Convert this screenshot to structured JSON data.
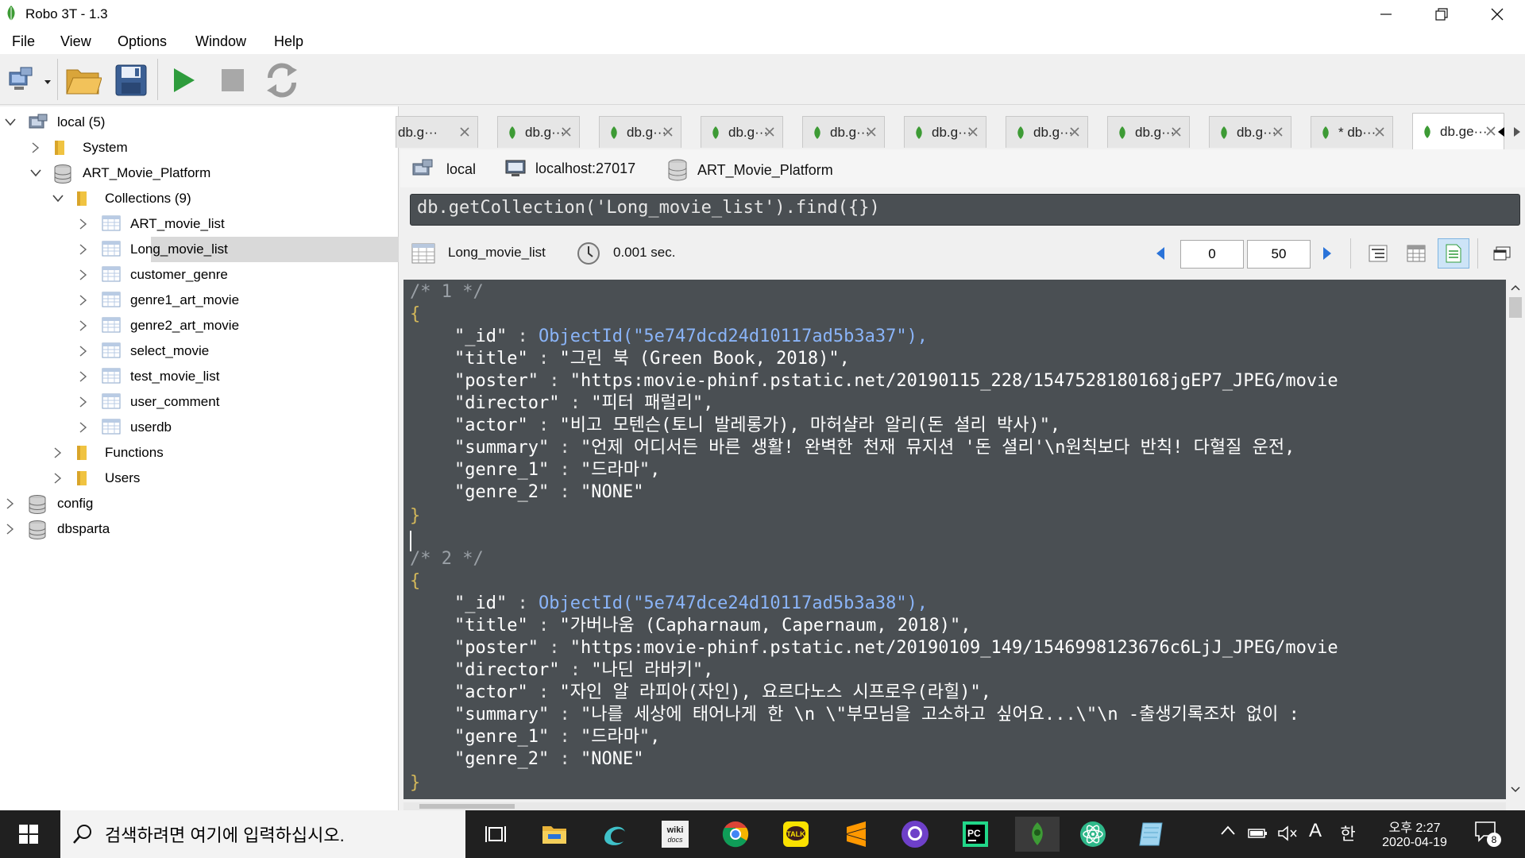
{
  "window": {
    "title": "Robo 3T - 1.3",
    "minimize": "—",
    "restore": "❐",
    "close": "✕"
  },
  "menu": [
    "File",
    "View",
    "Options",
    "Window",
    "Help"
  ],
  "tree": {
    "items": [
      {
        "label": "local (5)",
        "expanded": true
      },
      {
        "label": "System",
        "expanded": false
      },
      {
        "label": "ART_Movie_Platform",
        "expanded": true
      },
      {
        "label": "Collections (9)",
        "expanded": true
      },
      {
        "label": "ART_movie_list",
        "expanded": false
      },
      {
        "label": "Long_movie_list",
        "expanded": false,
        "selected": true
      },
      {
        "label": "customer_genre",
        "expanded": false
      },
      {
        "label": "genre1_art_movie",
        "expanded": false
      },
      {
        "label": "genre2_art_movie",
        "expanded": false
      },
      {
        "label": "select_movie",
        "expanded": false
      },
      {
        "label": "test_movie_list",
        "expanded": false
      },
      {
        "label": "user_comment",
        "expanded": false
      },
      {
        "label": "userdb",
        "expanded": false
      },
      {
        "label": "Functions",
        "expanded": false
      },
      {
        "label": "Users",
        "expanded": false
      },
      {
        "label": "config",
        "expanded": false
      },
      {
        "label": "dbsparta",
        "expanded": false
      }
    ]
  },
  "tabs": [
    {
      "label": "db.g··· "
    },
    {
      "label": "db.g··· "
    },
    {
      "label": "db.g··· "
    },
    {
      "label": "db.g··· "
    },
    {
      "label": "db.g··· "
    },
    {
      "label": "db.g··· "
    },
    {
      "label": "db.g··· "
    },
    {
      "label": "db.g··· "
    },
    {
      "label": "db.g··· "
    },
    {
      "label": "* db··· "
    },
    {
      "label": "db.ge··· ",
      "active": true
    }
  ],
  "connection": {
    "server": "local",
    "host": "localhost:27017",
    "database": "ART_Movie_Platform"
  },
  "query": "db.getCollection('Long_movie_list').find({})",
  "result": {
    "collection": "Long_movie_list",
    "time": "0.001 sec.",
    "skip": "0",
    "limit": "50"
  },
  "documents": [
    {
      "header": "/* 1 */",
      "fields": [
        {
          "key": "\"_id\"",
          "value": "ObjectId(\"5e747dcd24d10117ad5b3a37\"),",
          "is_fn": true
        },
        {
          "key": "\"title\"",
          "value": "\"그린 북 (Green Book, 2018)\","
        },
        {
          "key": "\"poster\"",
          "value": "\"https:movie-phinf.pstatic.net/20190115_228/1547528180168jgEP7_JPEG/movie"
        },
        {
          "key": "\"director\"",
          "value": "\"피터 패럴리\","
        },
        {
          "key": "\"actor\"",
          "value": "\"비고 모텐슨(토니 발레롱가), 마허샬라 알리(돈 셜리 박사)\","
        },
        {
          "key": "\"summary\"",
          "value": "\"언제 어디서든 바른 생활! 완벽한 천재 뮤지션 '돈 셜리'\\n원칙보다 반칙! 다혈질 운전,"
        },
        {
          "key": "\"genre_1\"",
          "value": "\"드라마\","
        },
        {
          "key": "\"genre_2\"",
          "value": "\"NONE\""
        }
      ]
    },
    {
      "header": "/* 2 */",
      "fields": [
        {
          "key": "\"_id\"",
          "value": "ObjectId(\"5e747dce24d10117ad5b3a38\"),",
          "is_fn": true
        },
        {
          "key": "\"title\"",
          "value": "\"가버나움 (Capharnaum, Capernaum, 2018)\","
        },
        {
          "key": "\"poster\"",
          "value": "\"https:movie-phinf.pstatic.net/20190109_149/1546998123676c6LjJ_JPEG/movie"
        },
        {
          "key": "\"director\"",
          "value": "\"나딘 라바키\","
        },
        {
          "key": "\"actor\"",
          "value": "\"자인 알 라피아(자인), 요르다노스 시프로우(라힐)\","
        },
        {
          "key": "\"summary\"",
          "value": "\"나를 세상에 태어나게 한 \\n \\\"부모님을 고소하고 싶어요...\\\"\\n -출생기록조차 없이 :"
        },
        {
          "key": "\"genre_1\"",
          "value": "\"드라마\","
        },
        {
          "key": "\"genre_2\"",
          "value": "\"NONE\""
        }
      ]
    }
  ],
  "taskbar": {
    "search_placeholder": "검색하려면 여기에 입력하십시오.",
    "clock_time": "오후 2:27",
    "clock_date": "2020-04-19",
    "ime_mode": "A",
    "ime_lang": "한",
    "notification_count": "8"
  },
  "colors": {
    "editor_bg": "#4a4f53",
    "brace": "#d4b85a",
    "comment": "#9aa0a6",
    "function": "#8ab4f8",
    "leaf": "#3d9b35",
    "selected_row": "#d9d9d9"
  }
}
